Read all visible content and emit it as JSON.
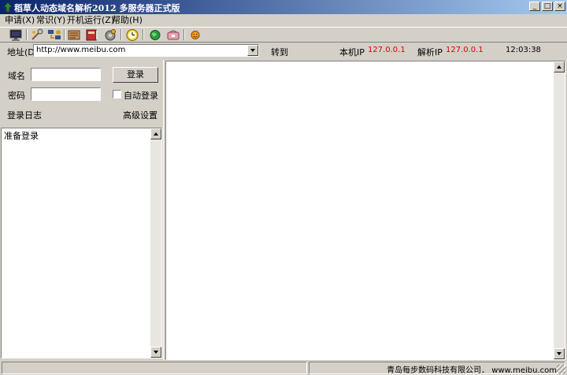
{
  "window": {
    "title": "稻草人动态域名解析2012 多服务器正式版",
    "buttons": [
      "_",
      "□",
      "×"
    ]
  },
  "menu": [
    {
      "label": "申请(X)"
    },
    {
      "label": "常识(Y)"
    },
    {
      "label": "开机运行(Z)"
    },
    {
      "label": "帮助(H)"
    }
  ],
  "toolbar_icons": [
    "monitor-icon",
    "tools-icon",
    "network-icon",
    "scroll-icon",
    "book-icon",
    "gear-icon",
    "clock-icon",
    "globe-icon",
    "package-icon",
    "smiley-icon"
  ],
  "address": {
    "label": "地址(D)",
    "url": "http://www.meibu.com",
    "go_label": "转到",
    "local_ip_label": "本机IP",
    "local_ip": "127.0.0.1",
    "resolved_ip_label": "解析IP",
    "resolved_ip": "127.0.0.1",
    "time": "12:03:38"
  },
  "login": {
    "domain_label": "域名",
    "domain_value": "",
    "password_label": "密码",
    "password_value": "",
    "login_button": "登录",
    "auto_login_label": "自动登录",
    "auto_login_checked": false,
    "log_label": "登录日志",
    "advanced_label": "高级设置"
  },
  "log_lines": [
    "准备登录"
  ],
  "colors": {
    "titlebar_start": "#0a246a",
    "titlebar_end": "#a6caf0",
    "ip_text": "#e00000",
    "face": "#d4d0c8"
  },
  "status": {
    "company": "青岛每步数码科技有限公司．  www.meibu.com"
  }
}
